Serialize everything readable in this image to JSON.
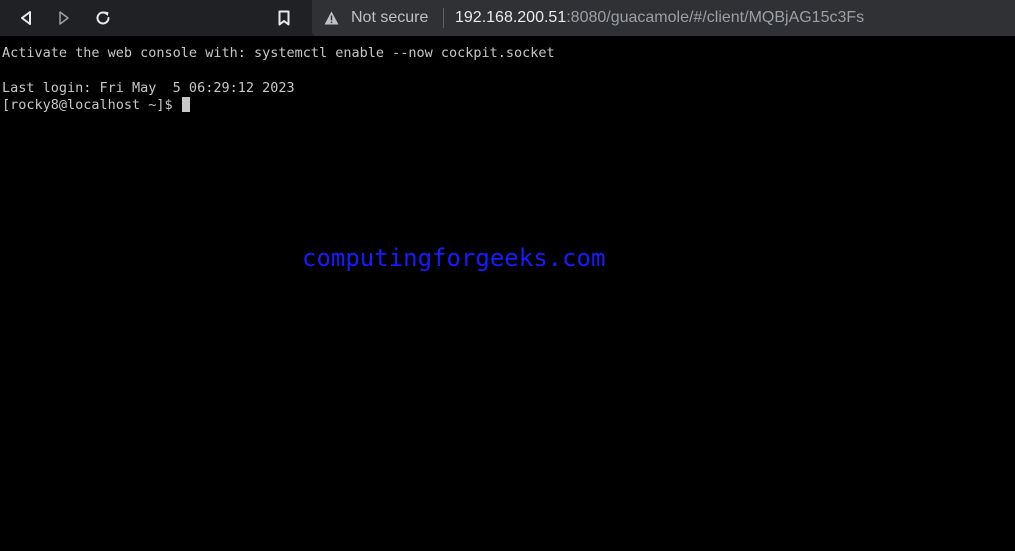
{
  "browser": {
    "security_label": "Not secure",
    "url_host": "192.168.200.51",
    "url_rest": ":8080/guacamole/#/client/MQBjAG15c3Fs",
    "icons": {
      "back": "back-arrow-icon",
      "forward": "forward-arrow-icon",
      "reload": "reload-icon",
      "bookmark": "bookmark-icon",
      "warning": "warning-triangle-icon"
    }
  },
  "terminal": {
    "line1": "Activate the web console with: systemctl enable --now cockpit.socket",
    "line2": "Last login: Fri May  5 06:29:12 2023",
    "prompt": "[rocky8@localhost ~]$ "
  },
  "watermark": "computingforgeeks.com",
  "colors": {
    "terminal_bg": "#000000",
    "terminal_fg": "#c8c8c8",
    "watermark": "#1a1aff",
    "toolbar_bg": "#202124"
  }
}
